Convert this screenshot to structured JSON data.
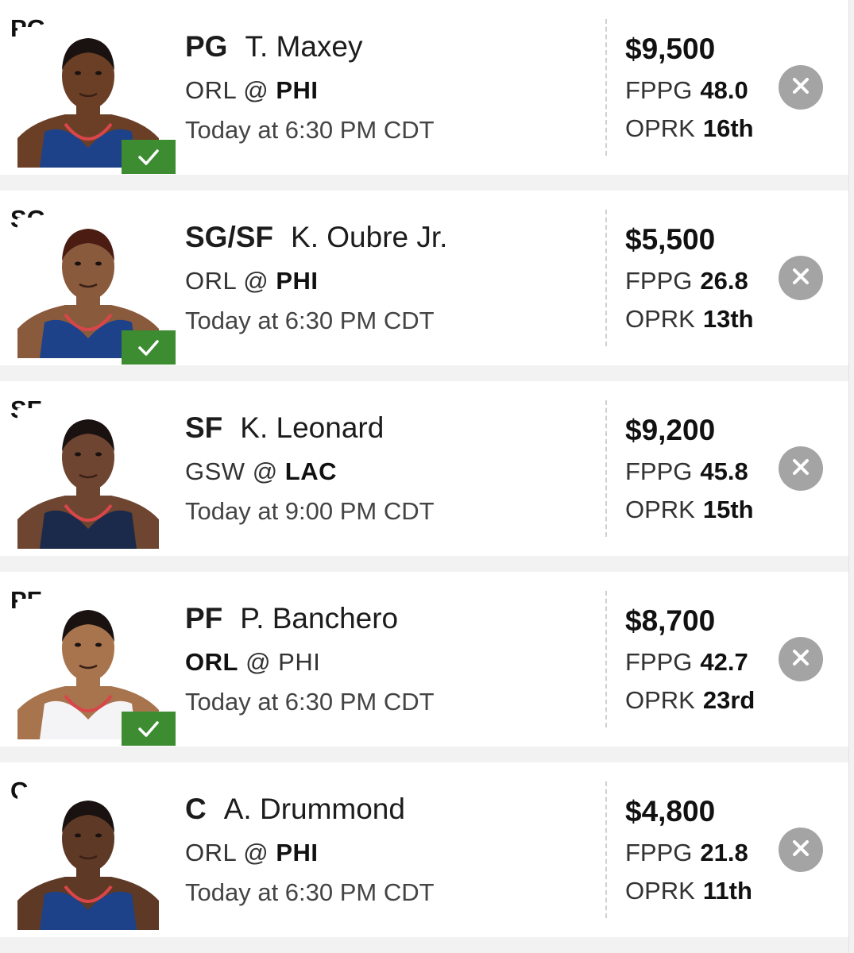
{
  "lineup": [
    {
      "slot": "PG",
      "position": "PG",
      "name": "T. Maxey",
      "away": "ORL",
      "at": "@",
      "home": "PHI",
      "bold_team": "home",
      "time": "Today at 6:30 PM CDT",
      "salary": "$9,500",
      "fppg_label": "FPPG",
      "fppg": "48.0",
      "oprk_label": "OPRK",
      "oprk": "16th",
      "checked": true,
      "jersey_color": "#1d428a",
      "skin_color": "#6b3f26",
      "hair_color": "#1a1210"
    },
    {
      "slot": "SG",
      "position": "SG/SF",
      "name": "K. Oubre Jr.",
      "away": "ORL",
      "at": "@",
      "home": "PHI",
      "bold_team": "home",
      "time": "Today at 6:30 PM CDT",
      "salary": "$5,500",
      "fppg_label": "FPPG",
      "fppg": "26.8",
      "oprk_label": "OPRK",
      "oprk": "13th",
      "checked": true,
      "jersey_color": "#1d428a",
      "skin_color": "#8a5a3c",
      "hair_color": "#4a1c12"
    },
    {
      "slot": "SF",
      "position": "SF",
      "name": "K. Leonard",
      "away": "GSW",
      "at": "@",
      "home": "LAC",
      "bold_team": "home",
      "time": "Today at 9:00 PM CDT",
      "salary": "$9,200",
      "fppg_label": "FPPG",
      "fppg": "45.8",
      "oprk_label": "OPRK",
      "oprk": "15th",
      "checked": false,
      "jersey_color": "#1b2a4a",
      "skin_color": "#6e4530",
      "hair_color": "#1a1210"
    },
    {
      "slot": "PF",
      "position": "PF",
      "name": "P. Banchero",
      "away": "ORL",
      "at": "@",
      "home": "PHI",
      "bold_team": "away",
      "time": "Today at 6:30 PM CDT",
      "salary": "$8,700",
      "fppg_label": "FPPG",
      "fppg": "42.7",
      "oprk_label": "OPRK",
      "oprk": "23rd",
      "checked": true,
      "jersey_color": "#f4f4f6",
      "skin_color": "#a8744e",
      "hair_color": "#1a1210"
    },
    {
      "slot": "C",
      "position": "C",
      "name": "A. Drummond",
      "away": "ORL",
      "at": "@",
      "home": "PHI",
      "bold_team": "home",
      "time": "Today at 6:30 PM CDT",
      "salary": "$4,800",
      "fppg_label": "FPPG",
      "fppg": "21.8",
      "oprk_label": "OPRK",
      "oprk": "11th",
      "checked": false,
      "jersey_color": "#1d428a",
      "skin_color": "#5e3a26",
      "hair_color": "#1a1210"
    }
  ],
  "colors": {
    "check_green": "#3d8c32",
    "remove_gray": "#a4a4a4",
    "background": "#f2f2f2"
  },
  "icons": {
    "check": "check-icon",
    "remove": "close-icon"
  }
}
